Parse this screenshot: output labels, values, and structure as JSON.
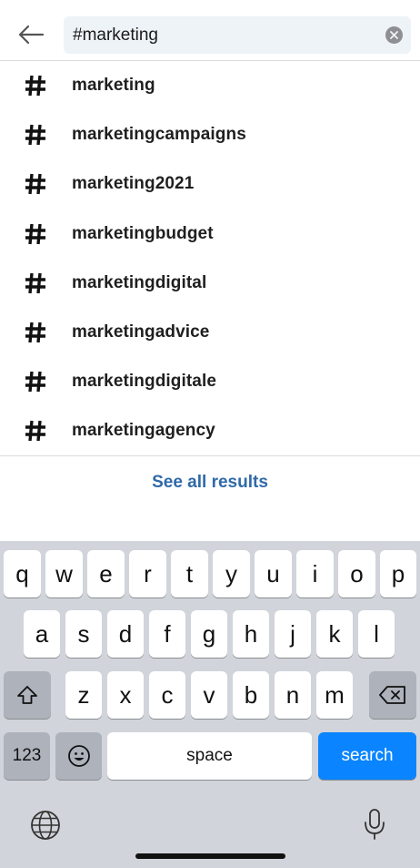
{
  "search": {
    "value": "#marketing",
    "back_icon": "arrow-left-icon",
    "clear_icon": "clear-circle-icon"
  },
  "results": [
    {
      "label": "marketing"
    },
    {
      "label": "marketingcampaigns"
    },
    {
      "label": "marketing2021"
    },
    {
      "label": "marketingbudget"
    },
    {
      "label": "marketingdigital"
    },
    {
      "label": "marketingadvice"
    },
    {
      "label": "marketingdigitale"
    },
    {
      "label": "marketingagency"
    }
  ],
  "see_all_label": "See all results",
  "colors": {
    "link": "#2f69a8",
    "search_key": "#0a84ff",
    "keyboard_bg": "#d1d4da"
  },
  "keyboard": {
    "row1": [
      "q",
      "w",
      "e",
      "r",
      "t",
      "y",
      "u",
      "i",
      "o",
      "p"
    ],
    "row2": [
      "a",
      "s",
      "d",
      "f",
      "g",
      "h",
      "j",
      "k",
      "l"
    ],
    "row3": [
      "z",
      "x",
      "c",
      "v",
      "b",
      "n",
      "m"
    ],
    "numbers_label": "123",
    "space_label": "space",
    "search_label": "search",
    "shift_icon": "shift-icon",
    "backspace_icon": "backspace-icon",
    "emoji_icon": "emoji-icon",
    "globe_icon": "globe-icon",
    "mic_icon": "microphone-icon"
  }
}
